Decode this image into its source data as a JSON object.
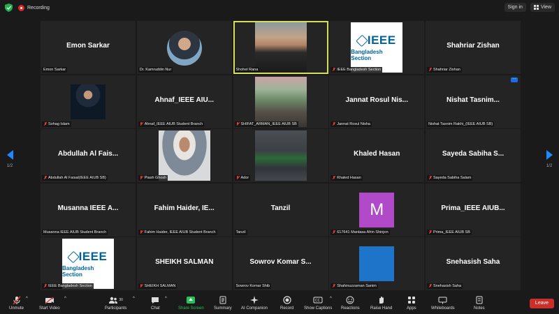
{
  "top": {
    "recording": "Recording",
    "sign_in": "Sign in",
    "view": "View"
  },
  "nav": {
    "page_left": "1/2",
    "page_right": "1/2"
  },
  "tiles": [
    {
      "name": "Emon Sarkar",
      "label": "Emon Sarkar",
      "muted": false
    },
    {
      "name": "",
      "label": "Dr. Kamruddin Nur",
      "muted": false
    },
    {
      "name": "",
      "label": "Shohel Rana",
      "muted": false
    },
    {
      "name": "",
      "label": "IEEE Bangladesh Section",
      "muted": true
    },
    {
      "name": "Shahriar Zishan",
      "label": "Shahriar Zishan",
      "muted": true
    },
    {
      "name": "",
      "label": "Sohag Islam",
      "muted": true
    },
    {
      "name": "Ahnaf_IEEE AIU...",
      "label": "Ahnaf_IEEE AIUB Student Branch",
      "muted": true
    },
    {
      "name": "",
      "label": "SHIFAT_ARMAN_IEEE AIUB SB",
      "muted": true
    },
    {
      "name": "Jannat Rosul Nis...",
      "label": "Jannat Rosul Nisha",
      "muted": true
    },
    {
      "name": "Nishat  Tasnim...",
      "label": "Nishat  Tasnim  Rakhi_(IEEE AIUB SB)",
      "muted": false
    },
    {
      "name": "Abdullah Al Fais...",
      "label": "Abdullah Al Faisal(IEEE AIUB SB)",
      "muted": true
    },
    {
      "name": "",
      "label": "Piash Ghosh",
      "muted": true
    },
    {
      "name": "",
      "label": "Ador",
      "muted": true
    },
    {
      "name": "Khaled Hasan",
      "label": "Khaled Hasan",
      "muted": true
    },
    {
      "name": "Sayeda Sabiha S...",
      "label": "Sayeda Sabiha Salam",
      "muted": true
    },
    {
      "name": "Musanna IEEE A...",
      "label": "Musanna IEEE AIUB Student Branch",
      "muted": false
    },
    {
      "name": "Fahim Haider, IE...",
      "label": "Fahim Haider, IEEE AIUB Student Branch",
      "muted": true
    },
    {
      "name": "Tanzil",
      "label": "Tanzil",
      "muted": false
    },
    {
      "name": "",
      "label": "617641 Mantasa Afrin Shinjon",
      "muted": true
    },
    {
      "name": "Prima_IEEE AIUB...",
      "label": "Prima_IEEE AIUB SB",
      "muted": true
    },
    {
      "name": "",
      "label": "IEEE Bangladesh Section",
      "muted": true
    },
    {
      "name": "SHEIKH SALMAN",
      "label": "SHEIKH SALMAN",
      "muted": true
    },
    {
      "name": "Sowrov Komar S...",
      "label": "Sowrov Komar Shib",
      "muted": false
    },
    {
      "name": "",
      "label": "Shahinuzzaman Sanim",
      "muted": true
    },
    {
      "name": "Snehasish Saha",
      "label": "Snehasish Saha",
      "muted": true
    }
  ],
  "ieee": {
    "logo_text": "IEEE",
    "sub_text": "Bangladesh Section"
  },
  "avatar_letter": "M",
  "toolbar": {
    "unmute": "Unmute",
    "start_video": "Start Video",
    "participants": "Participants",
    "participant_count": "30",
    "chat": "Chat",
    "share_screen": "Share Screen",
    "summary": "Summary",
    "ai_companion": "AI Companion",
    "record": "Record",
    "show_captions": "Show Captions",
    "reactions": "Reactions",
    "raise_hand": "Raise Hand",
    "apps": "Apps",
    "whiteboards": "Whiteboards",
    "notes": "Notes",
    "leave": "Leave"
  },
  "colors": {
    "accent": "#1e88ff",
    "active_border": "#d4e157",
    "leave": "#c9302c",
    "share": "#24c35a",
    "avatar": "#b04ac8"
  }
}
